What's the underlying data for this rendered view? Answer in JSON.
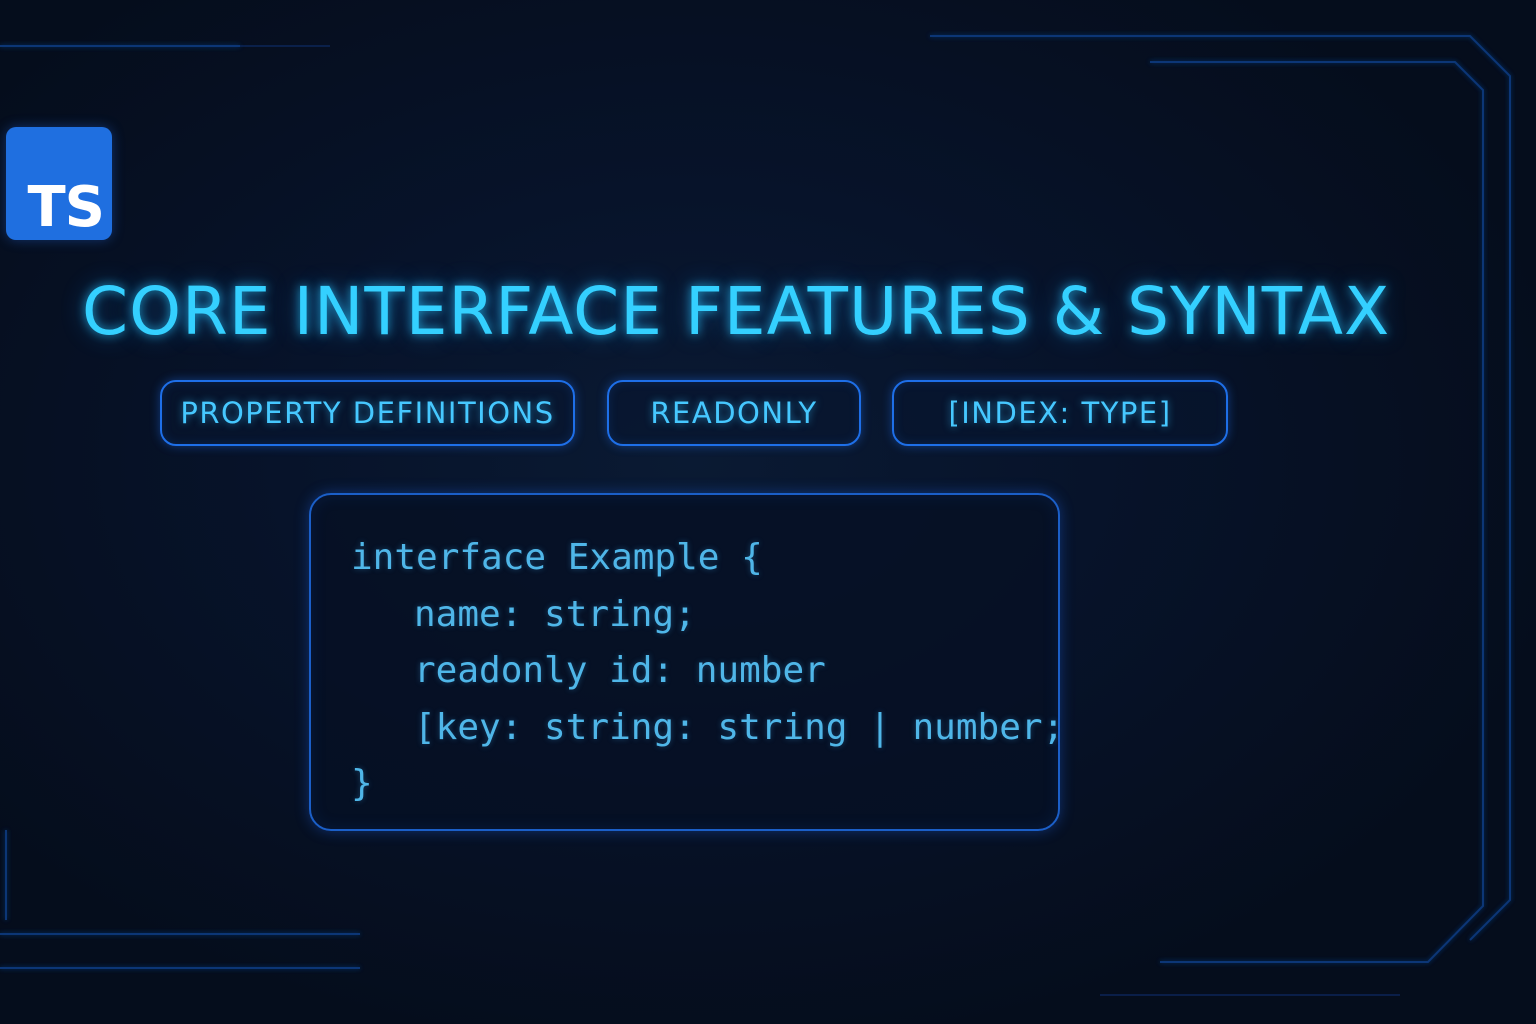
{
  "logo": {
    "text": "TS"
  },
  "title": "CORE INTERFACE FEATURES & SYNTAX",
  "chips": [
    {
      "label": "PROPERTY DEFINITIONS"
    },
    {
      "label": "READONLY"
    },
    {
      "label": "[INDEX: TYPE]"
    }
  ],
  "code": {
    "lines": [
      "interface Example {",
      "name: string;",
      "readonly id: number",
      "[key: string: string | number;",
      "}"
    ]
  },
  "colors": {
    "background": "#06101f",
    "accent_cyan": "#34d0ff",
    "border_blue": "#1e6fe8",
    "logo_blue": "#1f6fe0"
  }
}
